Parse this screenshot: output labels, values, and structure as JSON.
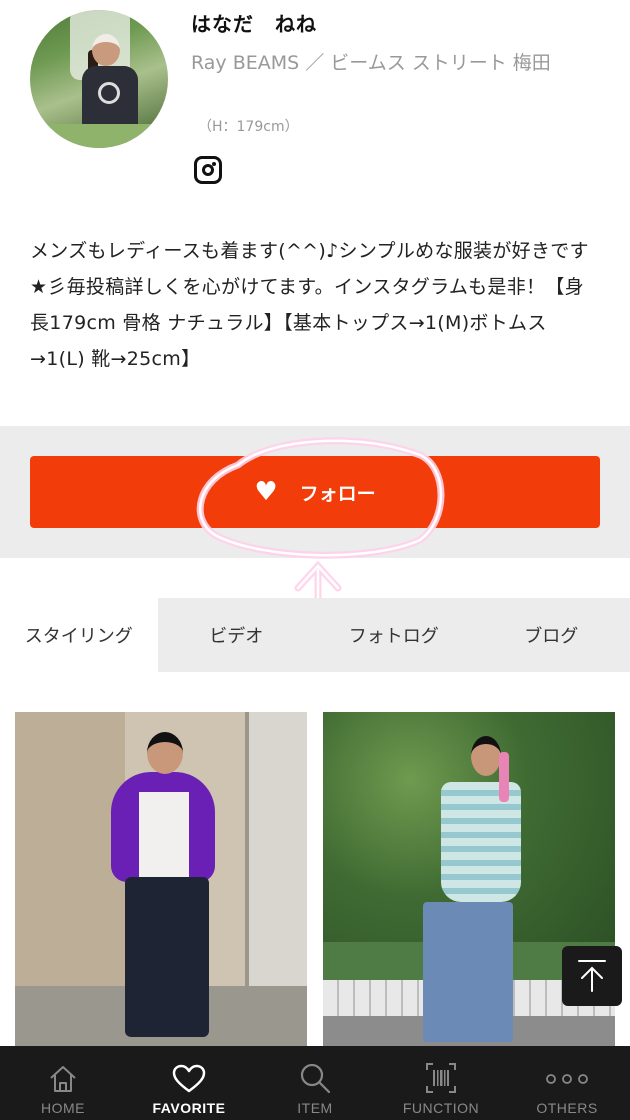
{
  "profile": {
    "name": "はなだ　ねね",
    "shop": "Ray BEAMS ／ ビームス ストリート 梅田",
    "height": "（H：179cm）",
    "bio": "メンズもレディースも着ます(^^)♪シンプルめな服装が好きです★彡毎投稿詳しくを心がけてます。インスタグラムも是非！【身長179cm 骨格 ナチュラル】【基本トップス→1(M)ボトムス→1(L) 靴→25cm】"
  },
  "follow": {
    "label": "フォロー"
  },
  "tabs": [
    {
      "label": "スタイリング"
    },
    {
      "label": "ビデオ"
    },
    {
      "label": "フォトログ"
    },
    {
      "label": "ブログ"
    }
  ],
  "bottom_nav": [
    {
      "label": "HOME",
      "icon": "home-icon"
    },
    {
      "label": "FAVORITE",
      "icon": "heart-icon"
    },
    {
      "label": "ITEM",
      "icon": "search-icon"
    },
    {
      "label": "FUNCTION",
      "icon": "barcode-icon"
    },
    {
      "label": "OTHERS",
      "icon": "more-icon"
    }
  ],
  "colors": {
    "accent": "#f23c0a",
    "tab_bar": "#1a1a1a",
    "band": "#ececec",
    "annotation": "#ffd1ea"
  }
}
